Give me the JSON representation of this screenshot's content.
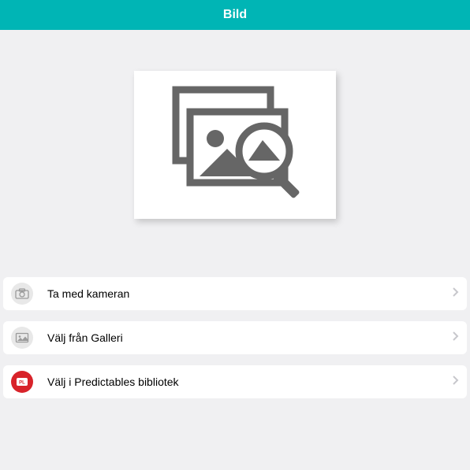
{
  "header": {
    "title": "Bild"
  },
  "options": [
    {
      "label": "Ta med kameran"
    },
    {
      "label": "Välj från Galleri"
    },
    {
      "label": "Välj i Predictables bibliotek"
    }
  ]
}
